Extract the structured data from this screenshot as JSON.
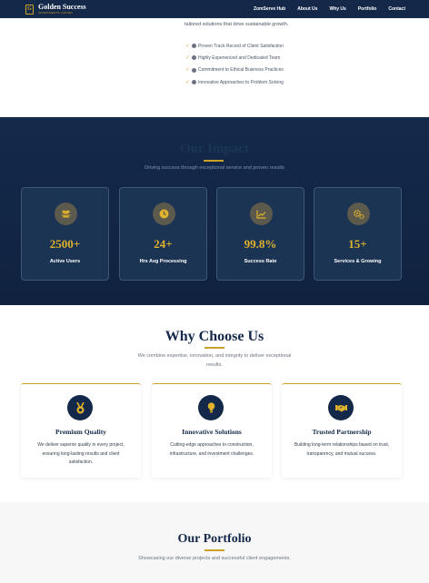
{
  "header": {
    "brand_name": "Golden Success",
    "brand_sub": "INVESTMENTS LIMITED",
    "nav": [
      "ZomServe Hub",
      "About Us",
      "Why Us",
      "Portfolio",
      "Contact"
    ]
  },
  "about": {
    "intro": "services. We pride ourselves on understanding the unique needs of our clients and providing tailored solutions that drive sustainable growth.",
    "points": [
      "Proven Track Record of Client Satisfaction",
      "Highly Experienced and Dedicated Team",
      "Commitment to Ethical Business Practices",
      "Innovative Approaches to Problem Solving"
    ]
  },
  "impact": {
    "title": "Our Impact",
    "subtitle": "Driving success through exceptional service and proven results",
    "stats": [
      {
        "value": "2500+",
        "label": "Active Users",
        "icon": "users-icon"
      },
      {
        "value": "24+",
        "label": "Hrs Avg Processing",
        "icon": "clock-icon"
      },
      {
        "value": "99.8%",
        "label": "Success Rate",
        "icon": "chart-line-icon"
      },
      {
        "value": "15+",
        "label": "Services & Growing",
        "icon": "gears-icon"
      }
    ]
  },
  "why": {
    "title": "Why Choose Us",
    "subtitle": "We combine expertise, innovation, and integrity to deliver exceptional results.",
    "features": [
      {
        "title": "Premium Quality",
        "text": "We deliver superior quality in every project, ensuring long-lasting results and client satisfaction.",
        "icon": "medal-icon"
      },
      {
        "title": "Innovative Solutions",
        "text": "Cutting-edge approaches to construction, infrastructure, and investment challenges.",
        "icon": "lightbulb-icon"
      },
      {
        "title": "Trusted Partnership",
        "text": "Building long-term relationships based on trust, transparency, and mutual success.",
        "icon": "handshake-icon"
      }
    ]
  },
  "portfolio": {
    "title": "Our Portfolio",
    "subtitle": "Showcasing our diverse projects and successful client engagements."
  },
  "colors": {
    "navy": "#14294a",
    "gold": "#c9a227",
    "stat_gold": "#e0b22e"
  }
}
